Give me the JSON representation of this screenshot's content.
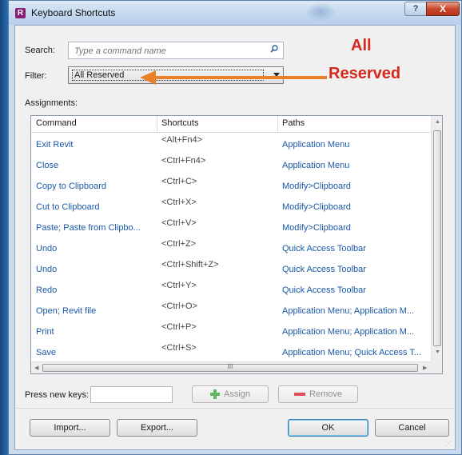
{
  "window": {
    "title": "Keyboard Shortcuts",
    "app_icon_letter": "R",
    "help_glyph": "?",
    "close_glyph": "X"
  },
  "search": {
    "label": "Search:",
    "placeholder": "Type a command name"
  },
  "filter": {
    "label": "Filter:",
    "value": "All Reserved"
  },
  "annotation": {
    "line1": "All",
    "line2": "Reserved",
    "color": "#d6281c",
    "arrow_color": "#e8812a"
  },
  "assignments": {
    "label": "Assignments:"
  },
  "table": {
    "columns": [
      "Command",
      "Shortcuts",
      "Paths"
    ],
    "rows": [
      {
        "command": "Exit Revit",
        "shortcut": "<Alt+Fn4>",
        "path": "Application Menu"
      },
      {
        "command": "Close",
        "shortcut": "<Ctrl+Fn4>",
        "path": "Application Menu"
      },
      {
        "command": "Copy to Clipboard",
        "shortcut": "<Ctrl+C>",
        "path": "Modify>Clipboard"
      },
      {
        "command": "Cut to Clipboard",
        "shortcut": "<Ctrl+X>",
        "path": "Modify>Clipboard"
      },
      {
        "command": "Paste; Paste from Clipbo...",
        "shortcut": "<Ctrl+V>",
        "path": "Modify>Clipboard"
      },
      {
        "command": "Undo",
        "shortcut": "<Ctrl+Z>",
        "path": "Quick Access Toolbar"
      },
      {
        "command": "Undo",
        "shortcut": "<Ctrl+Shift+Z>",
        "path": "Quick Access Toolbar"
      },
      {
        "command": "Redo",
        "shortcut": "<Ctrl+Y>",
        "path": "Quick Access Toolbar"
      },
      {
        "command": "Open; Revit file",
        "shortcut": "<Ctrl+O>",
        "path": "Application Menu; Application M..."
      },
      {
        "command": "Print",
        "shortcut": "<Ctrl+P>",
        "path": "Application Menu; Application M..."
      },
      {
        "command": "Save",
        "shortcut": "<Ctrl+S>",
        "path": "Application Menu; Quick Access T..."
      }
    ],
    "hscroll_grip": "III"
  },
  "new_keys": {
    "label": "Press new keys:",
    "value": ""
  },
  "buttons": {
    "assign": "Assign",
    "remove": "Remove",
    "import": "Import...",
    "export": "Export...",
    "ok": "OK",
    "cancel": "Cancel"
  }
}
